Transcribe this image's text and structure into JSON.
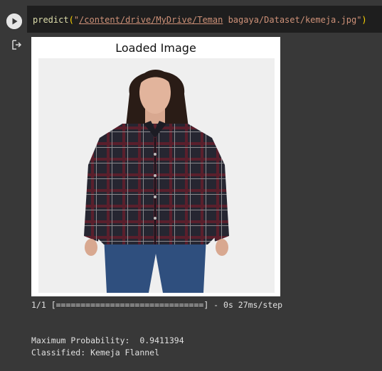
{
  "cell": {
    "code_fn": "predict",
    "code_open": "(",
    "code_quote_open": "\"",
    "code_path": "/content/drive/MyDrive/Teman",
    "code_path_rest": " bagaya/Dataset/kemeja.jpg",
    "code_quote_close": "\"",
    "code_close": ")"
  },
  "figure": {
    "title": "Loaded Image",
    "image_alt": "Woman wearing a dark plaid flannel shirt and jeans"
  },
  "output": {
    "progress_line": "1/1 [==============================] - 0s 27ms/step",
    "probability_line": "Maximum Probability:  0.9411394",
    "classified_line": "Classified: Kemeja Flannel"
  },
  "colors": {
    "editor_bg": "#1e1e1e",
    "cell_bg": "#383838",
    "string": "#ce9178",
    "function": "#dcdcaa"
  },
  "icons": {
    "run": "play-icon",
    "output": "output-redirect-icon"
  }
}
